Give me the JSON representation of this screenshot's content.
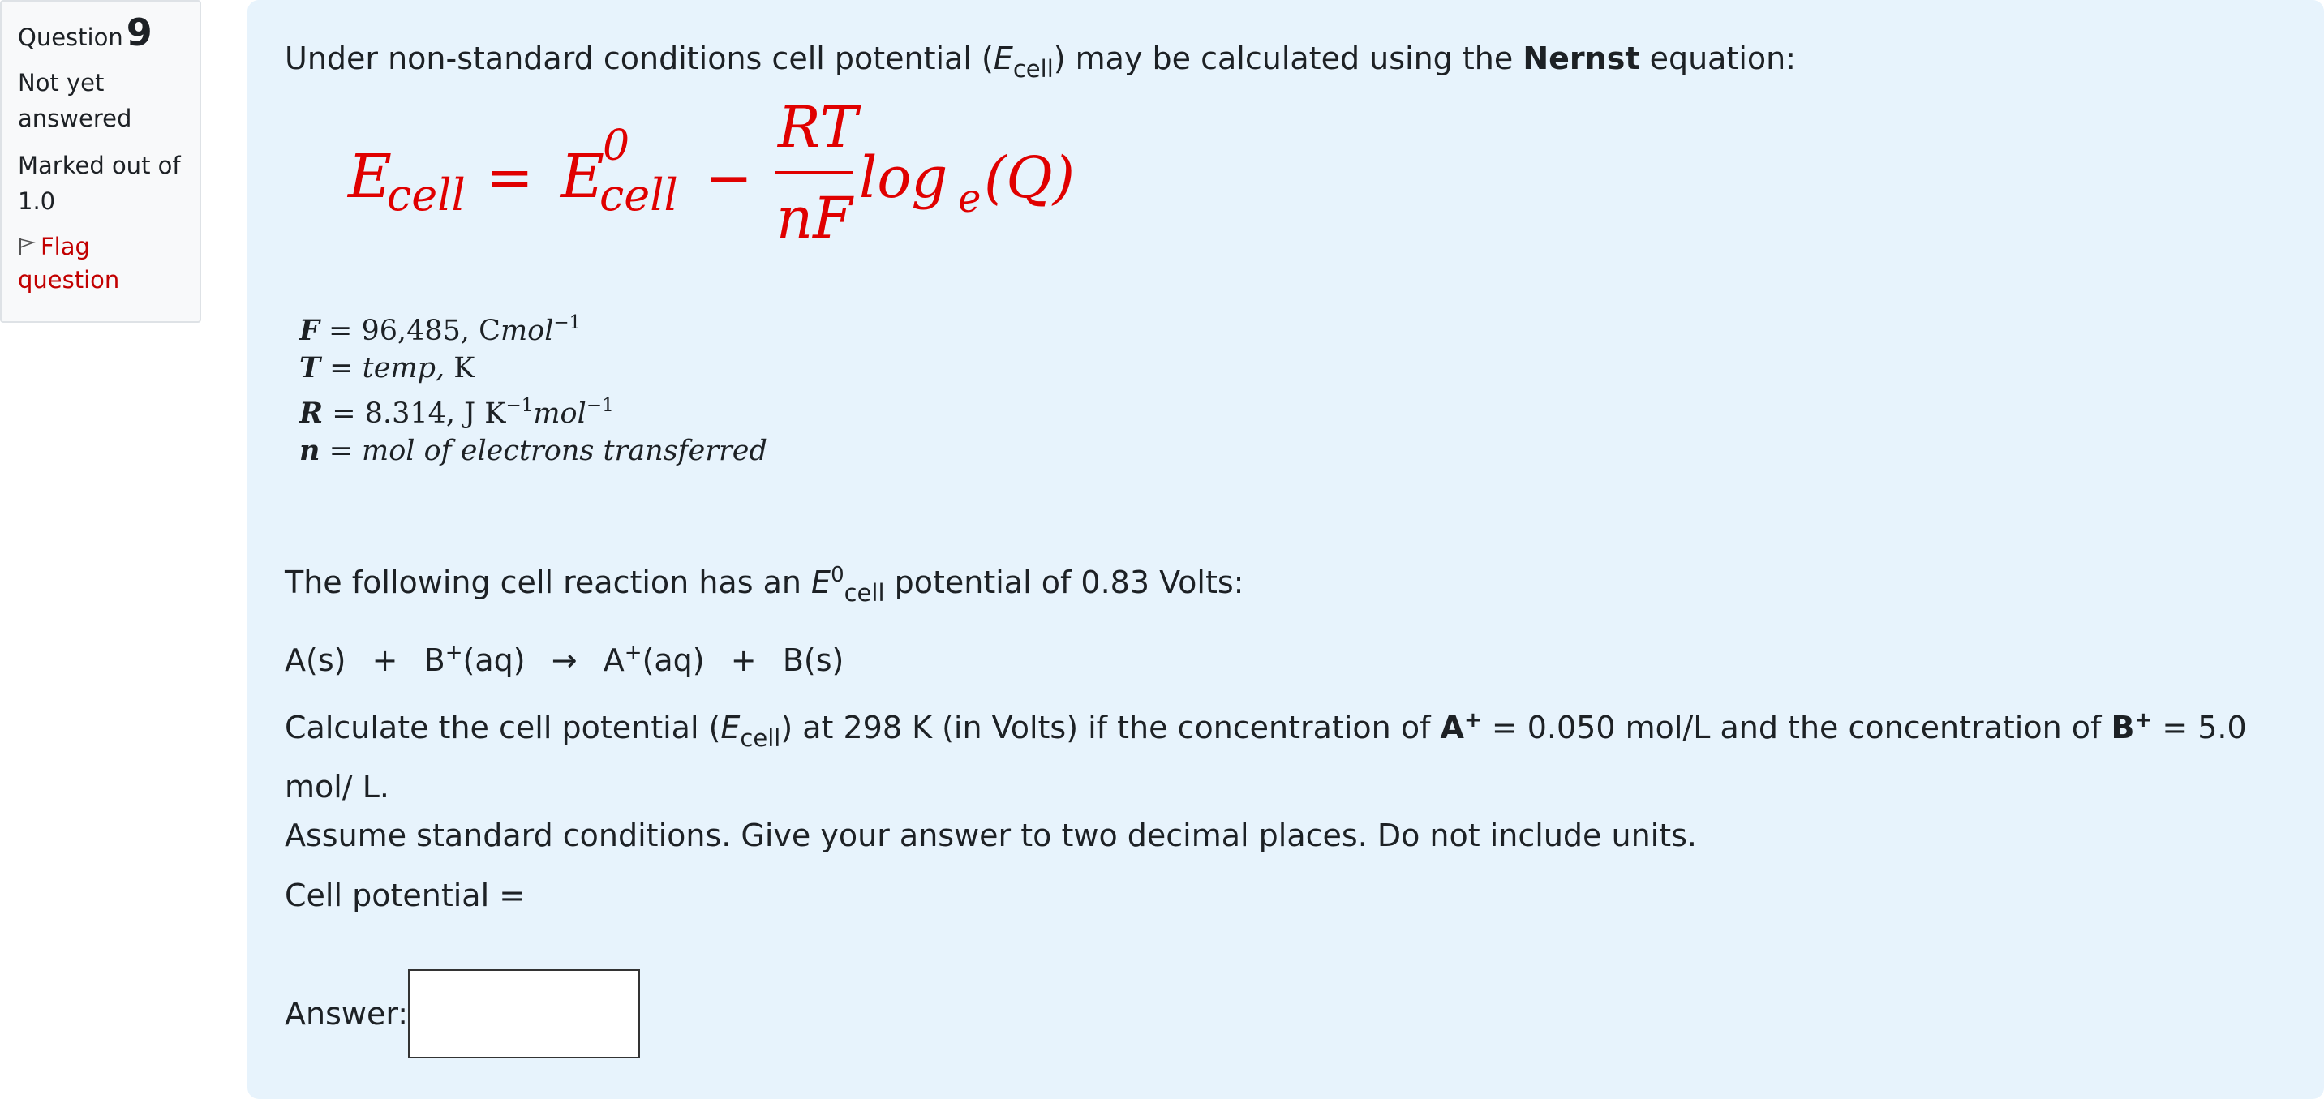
{
  "info": {
    "question_prefix": "Question",
    "question_number": "9",
    "state": "Not yet answered",
    "grade": "Marked out of 1.0",
    "flag_label": "Flag question"
  },
  "question": {
    "intro_pre": "Under non-standard conditions cell potential (",
    "intro_E": "E",
    "intro_sub": "cell",
    "intro_mid": ") may be calculated using the ",
    "intro_bold": "Nernst",
    "intro_post": " equation:",
    "formula": {
      "lhs_E": "E",
      "lhs_sub": "cell",
      "equals": "=",
      "e0_E": "E",
      "e0_sup": "0",
      "e0_sub": "cell",
      "minus": "−",
      "num": "RT",
      "den": "nF",
      "log": "log",
      "log_sub": "e",
      "arg": "(Q)"
    },
    "definitions": [
      {
        "sym": "F",
        "eq": " = ",
        "val": "96,485, C",
        "val_it": "mol",
        "sup": "−1",
        "tail": "",
        "tail_it": "",
        "tail_sup": ""
      },
      {
        "sym": "T",
        "eq": " = ",
        "val": "",
        "val_it": "temp,",
        "sup": "",
        "tail": " K",
        "tail_it": "",
        "tail_sup": ""
      },
      {
        "sym": "R",
        "eq": " = ",
        "val": "8.314, J K",
        "val_it": "",
        "sup": "−1",
        "tail": "",
        "tail_it": "mol",
        "tail_sup": "−1"
      },
      {
        "sym": "n",
        "eq": " = ",
        "val": "",
        "val_it": "mol of electrons transferred",
        "sup": "",
        "tail": "",
        "tail_it": "",
        "tail_sup": ""
      }
    ],
    "reaction_pre": "The following cell reaction has an ",
    "reaction_E": "E",
    "reaction_sup": "0",
    "reaction_sub": "cell",
    "reaction_post": " potential of 0.83 Volts:",
    "equation": {
      "a": "A(s)",
      "plus1": "+",
      "b": "B",
      "b_sup": "+",
      "b_state": "(aq)",
      "arrow": "→",
      "c": "A",
      "c_sup": "+",
      "c_state": "(aq)",
      "plus2": "+",
      "d": "B(s)"
    },
    "calc_pre": "Calculate the cell potential (",
    "calc_E": "E",
    "calc_sub": "cell",
    "calc_mid": ") at 298 K (in Volts) if the concentration of ",
    "calc_A": "A",
    "calc_A_sup": "+",
    "calc_mid2": " = 0.050 mol/L and the concentration of ",
    "calc_B": "B",
    "calc_B_sup": "+",
    "calc_post": " = 5.0 mol/ L.",
    "assume": "Assume standard conditions. Give your answer to two decimal places. Do not include units.",
    "cell_potential_label": "Cell potential ="
  },
  "answer": {
    "label": "Answer:",
    "value": ""
  }
}
